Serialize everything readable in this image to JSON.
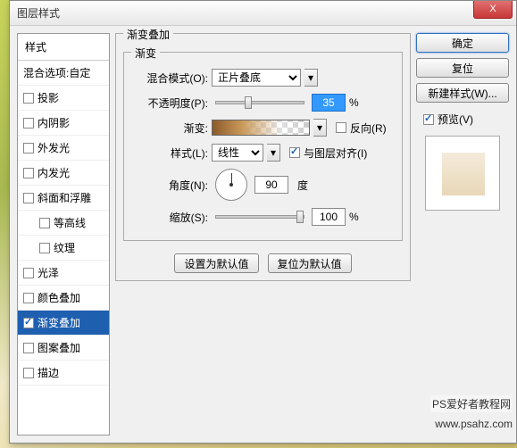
{
  "title": "图层样式",
  "close_x": "X",
  "left": {
    "header": "样式",
    "blend_opts": "混合选项:自定",
    "items": [
      {
        "label": "投影",
        "checked": false,
        "selected": false,
        "indent": false
      },
      {
        "label": "内阴影",
        "checked": false,
        "selected": false,
        "indent": false
      },
      {
        "label": "外发光",
        "checked": false,
        "selected": false,
        "indent": false
      },
      {
        "label": "内发光",
        "checked": false,
        "selected": false,
        "indent": false
      },
      {
        "label": "斜面和浮雕",
        "checked": false,
        "selected": false,
        "indent": false
      },
      {
        "label": "等高线",
        "checked": false,
        "selected": false,
        "indent": true
      },
      {
        "label": "纹理",
        "checked": false,
        "selected": false,
        "indent": true
      },
      {
        "label": "光泽",
        "checked": false,
        "selected": false,
        "indent": false
      },
      {
        "label": "颜色叠加",
        "checked": false,
        "selected": false,
        "indent": false
      },
      {
        "label": "渐变叠加",
        "checked": true,
        "selected": true,
        "indent": false
      },
      {
        "label": "图案叠加",
        "checked": false,
        "selected": false,
        "indent": false
      },
      {
        "label": "描边",
        "checked": false,
        "selected": false,
        "indent": false
      }
    ]
  },
  "mid": {
    "section_title": "渐变叠加",
    "group_title": "渐变",
    "blend_mode_label": "混合模式(O):",
    "blend_mode_value": "正片叠底",
    "opacity_label": "不透明度(P):",
    "opacity_value": "35",
    "percent": "%",
    "gradient_label": "渐变:",
    "reverse_label": "反向(R)",
    "style_label": "样式(L):",
    "style_value": "线性",
    "align_label": "与图层对齐(I)",
    "angle_label": "角度(N):",
    "angle_value": "90",
    "degree": "度",
    "scale_label": "缩放(S):",
    "scale_value": "100",
    "btn_default": "设置为默认值",
    "btn_reset": "复位为默认值"
  },
  "right": {
    "ok": "确定",
    "cancel": "复位",
    "new_style": "新建样式(W)...",
    "preview_label": "预览(V)"
  },
  "watermark1": "PS爱好者教程网",
  "watermark2": "www.psahz.com"
}
